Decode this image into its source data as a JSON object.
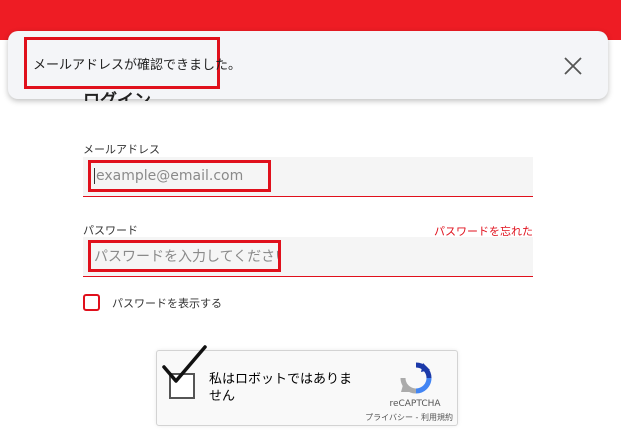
{
  "toast": {
    "message": "メールアドレスが確認できました。"
  },
  "login": {
    "title": "ログイン",
    "email": {
      "label": "メールアドレス",
      "placeholder": "example@email.com"
    },
    "password": {
      "label": "パスワード",
      "placeholder": "パスワードを入力してください",
      "forgot_link": "パスワードを忘れた"
    },
    "show_password_label": "パスワードを表示する"
  },
  "recaptcha": {
    "label": "私はロボットではありません",
    "brand": "reCAPTCHA",
    "privacy": "プライバシー",
    "separator": " - ",
    "terms": "利用規約",
    "checked": true
  },
  "colors": {
    "brand_red": "#ee1c24",
    "highlight_red": "#e0101c"
  }
}
